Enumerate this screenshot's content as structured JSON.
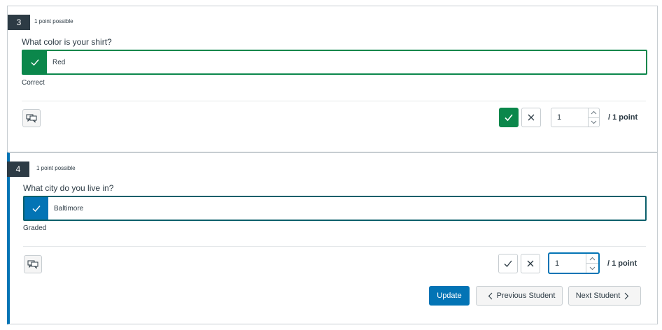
{
  "questions": [
    {
      "number": "3",
      "points_possible": "1 point possible",
      "text": "What color is your shirt?",
      "answer": "Red",
      "status": "Correct",
      "score": "1",
      "points_label": "/ 1 point"
    },
    {
      "number": "4",
      "points_possible": "1 point possible",
      "text": "What city do you live in?",
      "answer": "Baltimore",
      "status": "Graded",
      "score": "1",
      "points_label": "/ 1 point"
    }
  ],
  "footer": {
    "update": "Update",
    "previous": "Previous Student",
    "next": "Next Student"
  },
  "colors": {
    "correct_green": "#0b874b",
    "primary_blue": "#0374b5",
    "dark_badge": "#2d3b45"
  },
  "icons": [
    "check-icon",
    "x-icon",
    "comment-icon",
    "chevron-up-icon",
    "chevron-down-icon",
    "chevron-left-icon",
    "chevron-right-icon"
  ]
}
